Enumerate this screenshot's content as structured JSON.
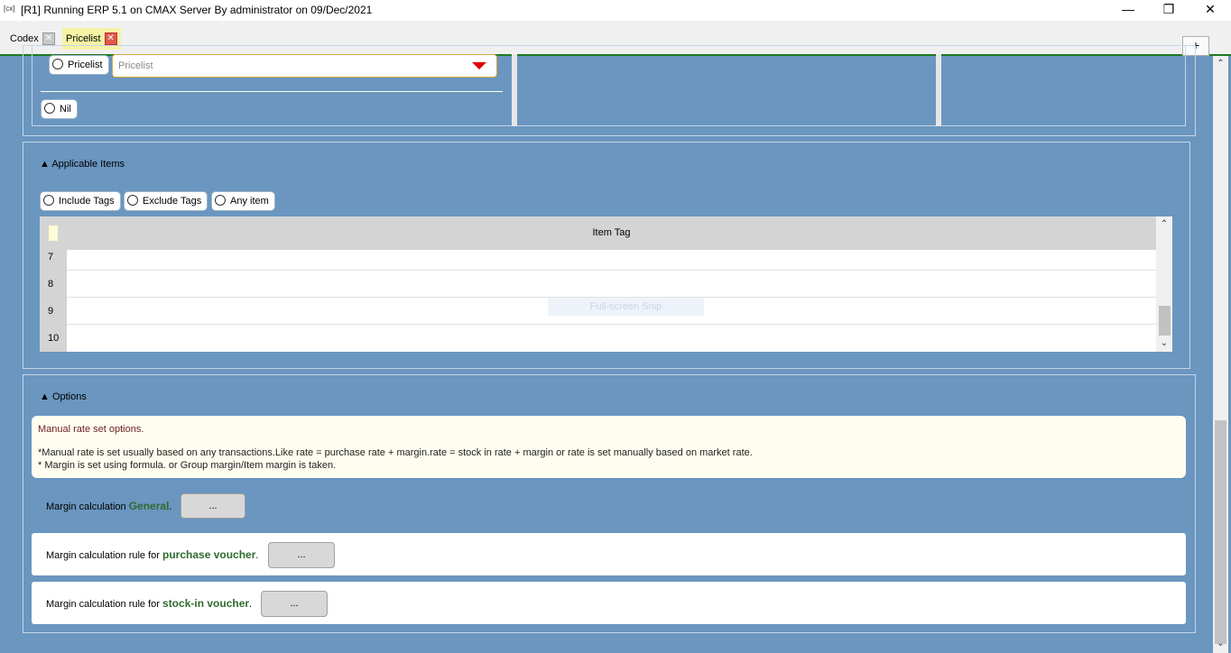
{
  "window": {
    "title": "[R1] Running ERP 5.1 on CMAX Server By administrator on 09/Dec/2021",
    "app_icon": "[cx]",
    "minimize_glyph": "—",
    "restore_glyph": "❐",
    "close_glyph": "✕"
  },
  "tabs": [
    {
      "label": "Codex",
      "close_glyph": "✕"
    },
    {
      "label": "Pricelist",
      "close_glyph": "✕"
    }
  ],
  "add_tab_label": "+",
  "pricelist_section": {
    "pricelist_radio_label": "Pricelist",
    "pricelist_select_placeholder": "Pricelist",
    "nil_radio_label": "Nil"
  },
  "applicable_items": {
    "title": "▲ Applicable Items",
    "radios": [
      "Include Tags",
      "Exclude Tags",
      "Any item"
    ],
    "grid": {
      "column_header": "Item Tag",
      "rows": [
        "7",
        "8",
        "9",
        "10"
      ],
      "scroll_up": "⌃",
      "scroll_down": "⌄"
    }
  },
  "watermark": "Full-screen Snip",
  "options": {
    "title": "▲ Options",
    "info_heading": "Manual rate set options.",
    "info_line1": "*Manual rate is set usually based on any transactions.Like rate = purchase rate + margin.rate = stock in rate + margin or rate is set manually based on market rate.",
    "info_line2": "* Margin is set using formula. or Group margin/Item margin is taken.",
    "rules": [
      {
        "prefix": "Margin calculation ",
        "keyword": "General",
        "suffix": ".",
        "button_label": "..."
      },
      {
        "prefix": "Margin calculation rule for ",
        "keyword": "purchase voucher",
        "suffix": ".",
        "button_label": "..."
      },
      {
        "prefix": "Margin calculation rule for ",
        "keyword": "stock-in voucher",
        "suffix": ".",
        "button_label": "..."
      }
    ]
  },
  "page_scroll": {
    "up": "⌃",
    "down": "⌄"
  }
}
